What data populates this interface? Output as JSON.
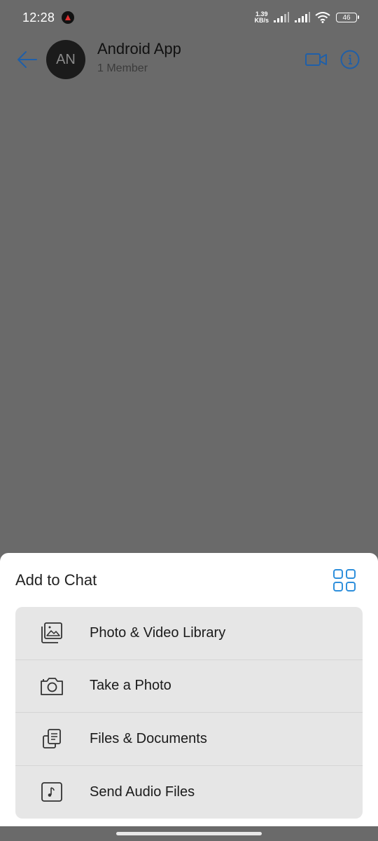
{
  "status_bar": {
    "time": "12:28",
    "speed_value": "1.39",
    "speed_unit": "KB/s",
    "battery": "46"
  },
  "chat_header": {
    "avatar_initials": "AN",
    "title": "Android App",
    "subtitle": "1 Member",
    "accent_color": "#1f5fa8"
  },
  "sheet": {
    "title": "Add to Chat",
    "grid_icon": "grid-icon",
    "options": [
      {
        "label": "Photo & Video Library",
        "icon": "photo-library-icon"
      },
      {
        "label": "Take a Photo",
        "icon": "camera-icon"
      },
      {
        "label": "Files & Documents",
        "icon": "documents-icon"
      },
      {
        "label": "Send Audio Files",
        "icon": "audio-file-icon"
      }
    ]
  },
  "colors": {
    "overlay": "#6a6a6a",
    "sheet_bg": "#ffffff",
    "option_bg": "#e6e6e6",
    "grid_icon": "#2e8fdc"
  }
}
